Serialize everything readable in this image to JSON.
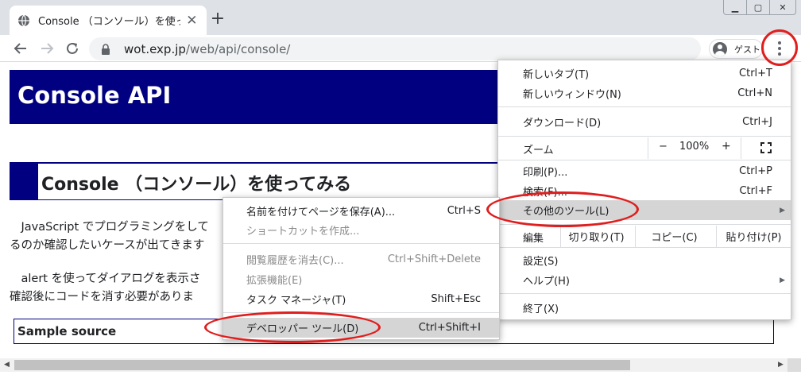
{
  "tab": {
    "title": "Console （コンソール）を使ってみる",
    "close_glyph": "✕"
  },
  "newtab_glyph": "+",
  "window": {
    "min": "▁",
    "max": "▢",
    "close": "✕"
  },
  "toolbar": {
    "url_host": "wot.exp.jp",
    "url_path": "/web/api/console/",
    "profile_name": "ゲスト"
  },
  "page": {
    "banner": "Console API",
    "heading": "Console （コンソール）を使ってみる",
    "para1_line1": "　JavaScript でプログラミングをして",
    "para1_line2": "るのか確認したいケースが出てきます",
    "para2_line1": "　alert を使ってダイアログを表示さ",
    "para2_line2": "確認後にコードを消す必要がありま",
    "sample_label": "Sample source"
  },
  "main_menu": {
    "new_tab": {
      "label": "新しいタブ(T)",
      "shortcut": "Ctrl+T"
    },
    "new_window": {
      "label": "新しいウィンドウ(N)",
      "shortcut": "Ctrl+N"
    },
    "downloads": {
      "label": "ダウンロード(D)",
      "shortcut": "Ctrl+J"
    },
    "zoom": {
      "label": "ズーム",
      "minus": "−",
      "value": "100%",
      "plus": "+"
    },
    "print": {
      "label": "印刷(P)...",
      "shortcut": "Ctrl+P"
    },
    "search": {
      "label": "検索(F)...",
      "shortcut": "Ctrl+F"
    },
    "more_tools": {
      "label": "その他のツール(L)",
      "arrow": "▶"
    },
    "edit": {
      "label": "編集",
      "cut": "切り取り(T)",
      "copy": "コピー(C)",
      "paste": "貼り付け(P)"
    },
    "settings": {
      "label": "設定(S)"
    },
    "help": {
      "label": "ヘルプ(H)",
      "arrow": "▶"
    },
    "exit": {
      "label": "終了(X)"
    }
  },
  "sub_menu": {
    "save_page": {
      "label": "名前を付けてページを保存(A)...",
      "shortcut": "Ctrl+S"
    },
    "create_shortcut": {
      "label": "ショートカットを作成..."
    },
    "clear_history": {
      "label": "閲覧履歴を消去(C)...",
      "shortcut": "Ctrl+Shift+Delete"
    },
    "extensions": {
      "label": "拡張機能(E)"
    },
    "task_manager": {
      "label": "タスク マネージャ(T)",
      "shortcut": "Shift+Esc"
    },
    "devtools": {
      "label": "デベロッパー ツール(D)",
      "shortcut": "Ctrl+Shift+I"
    }
  },
  "scrollbar": {
    "left": "◀",
    "right": "▶"
  },
  "colors": {
    "banner": "#000080",
    "annotation": "#e01e1e",
    "highlight": "#d5d5d5"
  }
}
